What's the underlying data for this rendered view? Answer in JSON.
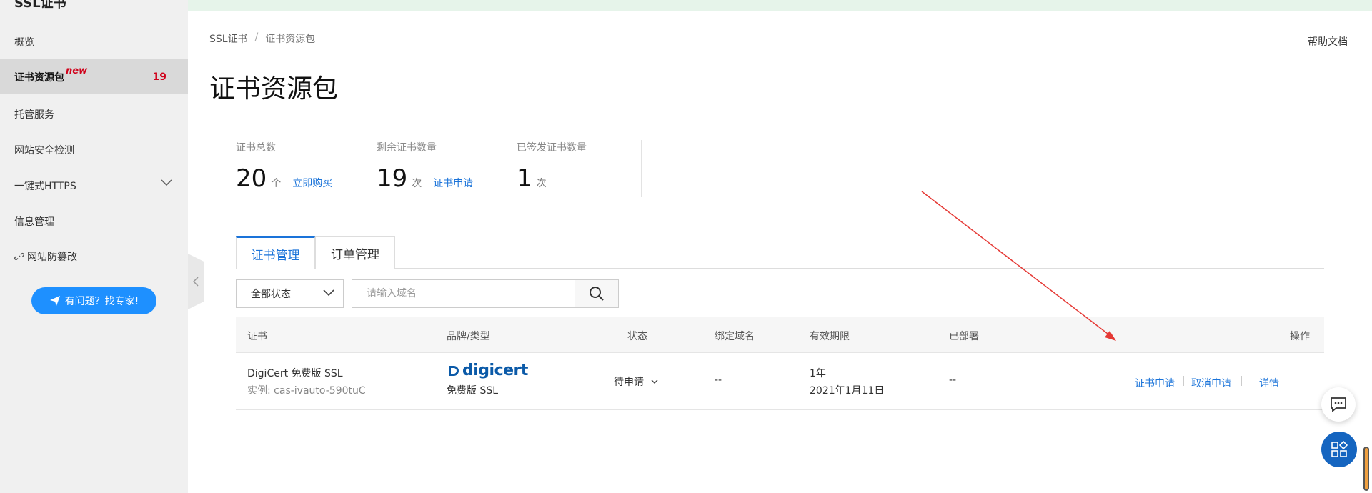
{
  "sidebar": {
    "title": "SSL证书",
    "items": [
      {
        "label": "概览"
      },
      {
        "label": "证书资源包",
        "new_tag": "new",
        "badge": "19"
      },
      {
        "label": "托管服务"
      },
      {
        "label": "网站安全检测"
      },
      {
        "label": "一键式HTTPS"
      },
      {
        "label": "信息管理"
      },
      {
        "label": "网站防篡改"
      }
    ],
    "help_button": "有问题？找专家!"
  },
  "breadcrumb": {
    "root": "SSL证书",
    "separator": "/",
    "current": "证书资源包"
  },
  "help_doc": "帮助文档",
  "page_title": "证书资源包",
  "stats": [
    {
      "label": "证书总数",
      "value": "20",
      "unit": "个",
      "action": "立即购买"
    },
    {
      "label": "剩余证书数量",
      "value": "19",
      "unit": "次",
      "action": "证书申请"
    },
    {
      "label": "已签发证书数量",
      "value": "1",
      "unit": "次",
      "action": ""
    }
  ],
  "tabs": [
    {
      "label": "证书管理",
      "active": true
    },
    {
      "label": "订单管理",
      "active": false
    }
  ],
  "filters": {
    "status_selected": "全部状态",
    "search_placeholder": "请输入域名"
  },
  "table": {
    "columns": [
      "证书",
      "品牌/类型",
      "状态",
      "绑定域名",
      "有效期限",
      "已部署",
      "操作"
    ],
    "rows": [
      {
        "cert_name": "DigiCert 免费版 SSL",
        "instance": "实例: cas-ivauto-590tuC",
        "brand_logo": "digicert",
        "brand_type": "免费版 SSL",
        "status": "待申请",
        "domain": "--",
        "validity": "1年",
        "expiry": "2021年1月11日",
        "deployed": "--",
        "actions": [
          "证书申请",
          "取消申请",
          "详情"
        ]
      }
    ]
  },
  "colors": {
    "accent": "#1a73d9",
    "badge": "#d0021b",
    "annotation": "#e53935"
  }
}
